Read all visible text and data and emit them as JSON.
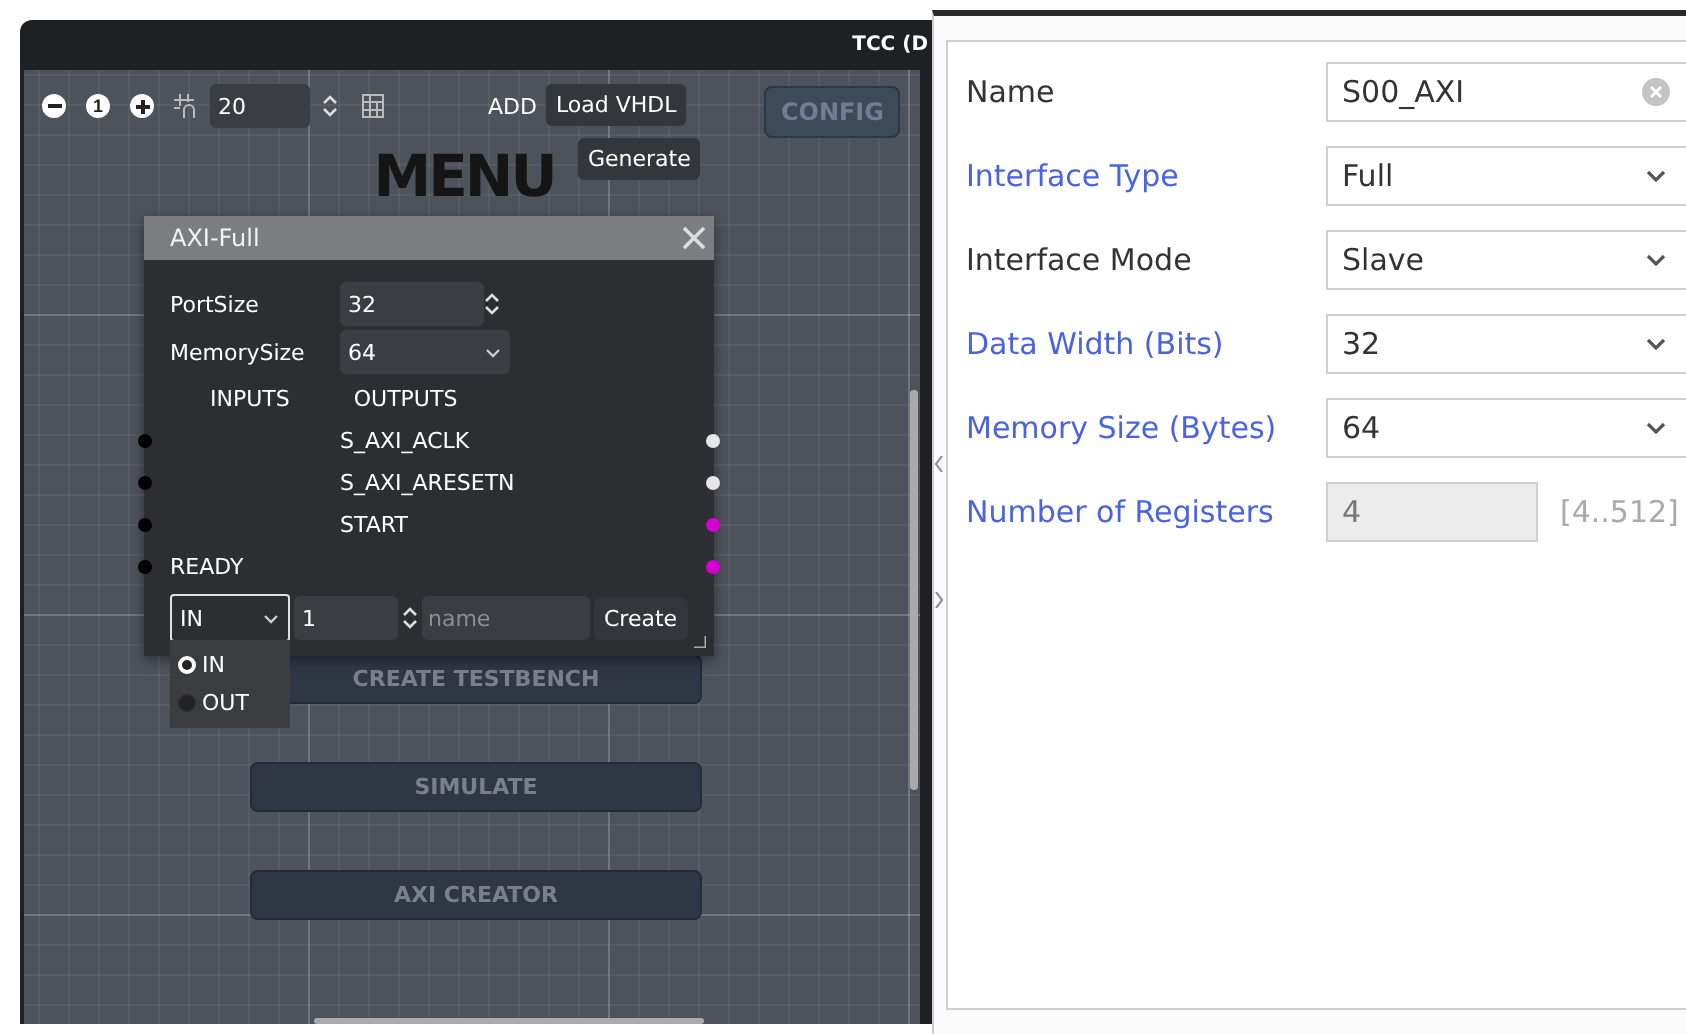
{
  "window": {
    "title": "TCC (D"
  },
  "toolbar": {
    "reset_label": "1",
    "grid_size": "20",
    "add_label": "ADD",
    "buttons": [
      "Load VHDL",
      "Generate"
    ],
    "config_label": "CONFIG"
  },
  "menu": {
    "title": "MENU",
    "items": [
      "CREATE TESTBENCH",
      "SIMULATE",
      "AXI CREATOR"
    ]
  },
  "dialog": {
    "title": "AXI-Full",
    "fields": [
      {
        "label": "PortSize",
        "value": "32",
        "kind": "spin"
      },
      {
        "label": "MemorySize",
        "value": "64",
        "kind": "select"
      }
    ],
    "headers": [
      "INPUTS",
      "OUTPUTS"
    ],
    "ports": [
      {
        "label": "S_AXI_ACLK",
        "kind": "output",
        "color": "#e6e6e6"
      },
      {
        "label": "S_AXI_ARESETN",
        "kind": "output",
        "color": "#e6e6e6"
      },
      {
        "label": "START",
        "kind": "output",
        "color": "#d400d4"
      },
      {
        "label": "READY",
        "kind": "input",
        "color": "#d400d4"
      }
    ],
    "new_port": {
      "direction": "IN",
      "count": "1",
      "placeholder": "name",
      "button": "Create",
      "options": [
        {
          "label": "IN",
          "selected": true
        },
        {
          "label": "OUT",
          "selected": false
        }
      ]
    }
  },
  "properties": [
    {
      "label": "Name",
      "color": "#333333",
      "kind": "text",
      "value": "S00_AXI"
    },
    {
      "label": "Interface Type",
      "color": "#4a63e0",
      "kind": "select",
      "value": "Full"
    },
    {
      "label": "Interface Mode",
      "color": "#333333",
      "kind": "select",
      "value": "Slave"
    },
    {
      "label": "Data Width (Bits)",
      "color": "#4a63e0",
      "kind": "select",
      "value": "32"
    },
    {
      "label": "Memory Size (Bytes)",
      "color": "#4a63e0",
      "kind": "select",
      "value": "64"
    },
    {
      "label": "Number of Registers",
      "color": "#4a63e0",
      "kind": "disabled",
      "value": "4",
      "range": "[4..512]"
    }
  ]
}
